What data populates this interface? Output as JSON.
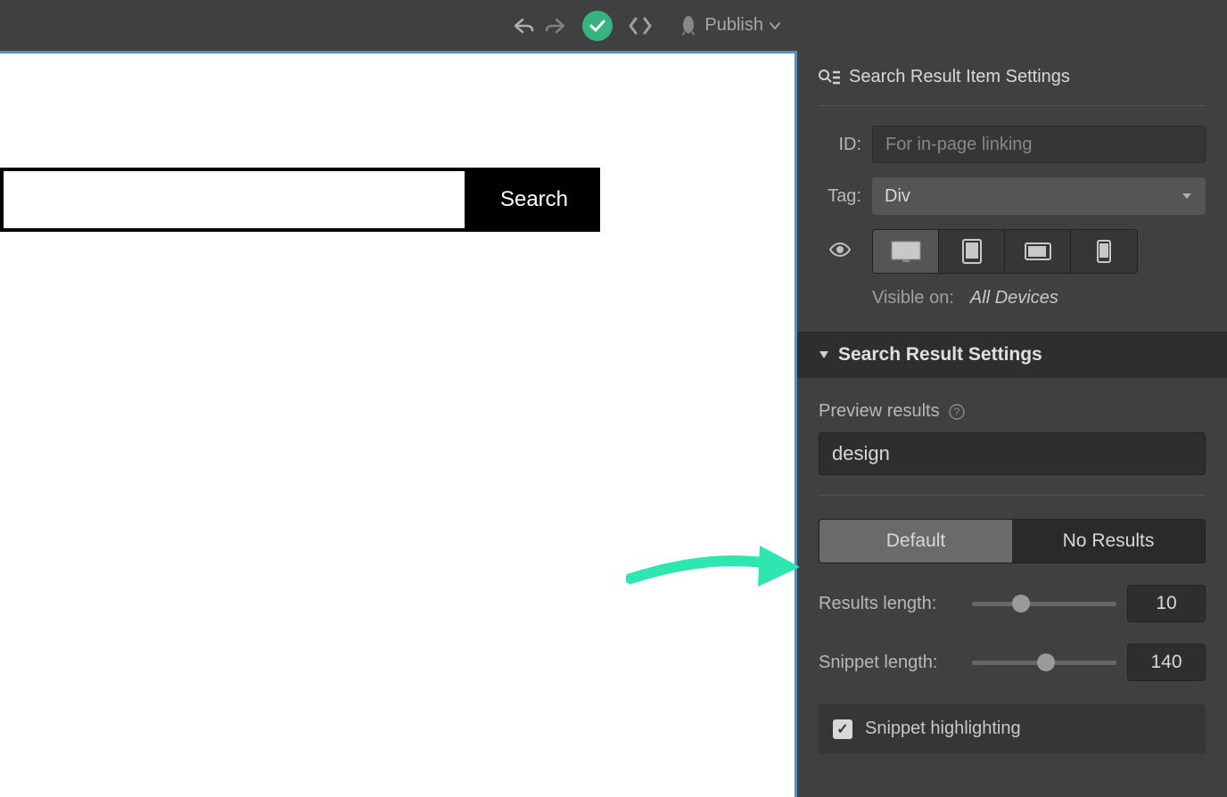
{
  "toolbar": {
    "publish_label": "Publish"
  },
  "canvas": {
    "search_button_label": "Search"
  },
  "panel": {
    "header_title": "Search Result Item Settings",
    "id_label": "ID:",
    "id_placeholder": "For in-page linking",
    "tag_label": "Tag:",
    "tag_value": "Div",
    "visible_on_label": "Visible on:",
    "visible_on_value": "All Devices",
    "section_title": "Search Result Settings",
    "preview_label": "Preview results",
    "preview_value": "design",
    "toggle_default": "Default",
    "toggle_no_results": "No Results",
    "results_length_label": "Results length:",
    "results_length_value": "10",
    "snippet_length_label": "Snippet length:",
    "snippet_length_value": "140",
    "snippet_highlighting_label": "Snippet highlighting"
  }
}
